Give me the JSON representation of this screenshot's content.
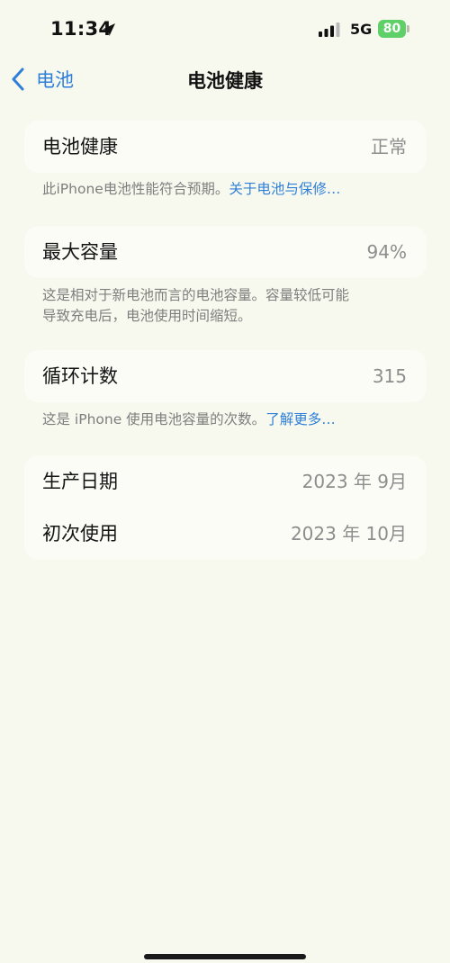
{
  "status_bar": {
    "time": "11:34",
    "network": "5G",
    "battery_percent": "80"
  },
  "nav": {
    "back_label": "电池",
    "title": "电池健康"
  },
  "battery_health": {
    "label": "电池健康",
    "value": "正常",
    "footnote_text": "此iPhone电池性能符合预期。",
    "footnote_link": "关于电池与保修…"
  },
  "max_capacity": {
    "label": "最大容量",
    "value": "94%",
    "footnote_line1": "这是相对于新电池而言的电池容量。容量较低可能",
    "footnote_line2": "导致充电后，电池使用时间缩短。"
  },
  "cycle_count": {
    "label": "循环计数",
    "value": "315",
    "footnote_text": "这是 iPhone 使用电池容量的次数。",
    "footnote_link": "了解更多…"
  },
  "dates": {
    "manufacture_label": "生产日期",
    "manufacture_value": "2023 年 9月",
    "first_use_label": "初次使用",
    "first_use_value": "2023 年 10月"
  },
  "colors": {
    "background": "#f7f9ee",
    "accent": "#2f7fd8",
    "battery_fill": "#5fd068"
  }
}
